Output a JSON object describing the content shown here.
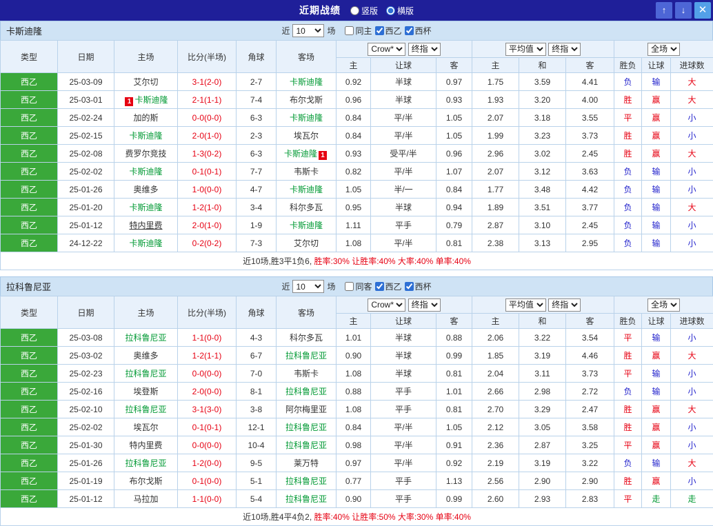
{
  "topbar": {
    "title": "近期战绩",
    "radios": [
      {
        "label": "竖版",
        "selected": false
      },
      {
        "label": "横版",
        "selected": true
      }
    ],
    "up_icon": "↑",
    "down_icon": "↓",
    "close_icon": "✕"
  },
  "filters": {
    "near": "近",
    "count": "10",
    "games": "场",
    "league": "西乙",
    "cup": "西杯"
  },
  "header": {
    "cols": {
      "type": "类型",
      "date": "日期",
      "home": "主场",
      "score": "比分(半场)",
      "corner": "角球",
      "away": "客场"
    },
    "selects": {
      "book": "Crow*",
      "book_kind": "终指",
      "avg": "平均值",
      "avg_kind": "终指",
      "scope": "全场"
    },
    "sub": {
      "home": "主",
      "handicap": "让球",
      "away": "客",
      "avg_home": "主",
      "avg_draw": "和",
      "avg_away": "客",
      "result": "胜负",
      "let_result": "让球",
      "goals": "进球数"
    }
  },
  "sections": [
    {
      "team": "卡斯迪隆",
      "same_label": "同主",
      "same_checked": false,
      "league_checked": true,
      "cup_checked": true,
      "rows": [
        {
          "league": "西乙",
          "date": "25-03-09",
          "home": {
            "name": "艾尔切"
          },
          "score": "3-1(2-0)",
          "corner": "2-7",
          "away": {
            "name": "卡斯迪隆",
            "focus": true
          },
          "odds": [
            "0.92",
            "半球",
            "0.97"
          ],
          "avg": [
            "1.75",
            "3.59",
            "4.41"
          ],
          "result": {
            "t": "负",
            "c": "blue"
          },
          "let": {
            "t": "输",
            "c": "blue"
          },
          "goal": {
            "t": "大",
            "c": "red"
          }
        },
        {
          "league": "西乙",
          "date": "25-03-01",
          "home": {
            "name": "卡斯迪隆",
            "focus": true,
            "card_pre": "1"
          },
          "score": "2-1(1-1)",
          "corner": "7-4",
          "away": {
            "name": "布尔戈斯"
          },
          "odds": [
            "0.96",
            "半球",
            "0.93"
          ],
          "avg": [
            "1.93",
            "3.20",
            "4.00"
          ],
          "result": {
            "t": "胜",
            "c": "red"
          },
          "let": {
            "t": "赢",
            "c": "red"
          },
          "goal": {
            "t": "大",
            "c": "red"
          }
        },
        {
          "league": "西乙",
          "date": "25-02-24",
          "home": {
            "name": "加的斯"
          },
          "score": "0-0(0-0)",
          "corner": "6-3",
          "away": {
            "name": "卡斯迪隆",
            "focus": true
          },
          "odds": [
            "0.84",
            "平/半",
            "1.05"
          ],
          "avg": [
            "2.07",
            "3.18",
            "3.55"
          ],
          "result": {
            "t": "平",
            "c": "red"
          },
          "let": {
            "t": "赢",
            "c": "red"
          },
          "goal": {
            "t": "小",
            "c": "blue"
          }
        },
        {
          "league": "西乙",
          "date": "25-02-15",
          "home": {
            "name": "卡斯迪隆",
            "focus": true
          },
          "score": "2-0(1-0)",
          "corner": "2-3",
          "away": {
            "name": "埃瓦尔"
          },
          "odds": [
            "0.84",
            "平/半",
            "1.05"
          ],
          "avg": [
            "1.99",
            "3.23",
            "3.73"
          ],
          "result": {
            "t": "胜",
            "c": "red"
          },
          "let": {
            "t": "赢",
            "c": "red"
          },
          "goal": {
            "t": "小",
            "c": "blue"
          }
        },
        {
          "league": "西乙",
          "date": "25-02-08",
          "home": {
            "name": "费罗尔竞技"
          },
          "score": "1-3(0-2)",
          "corner": "6-3",
          "away": {
            "name": "卡斯迪隆",
            "focus": true,
            "card_post": "1"
          },
          "odds": [
            "0.93",
            "受平/半",
            "0.96"
          ],
          "avg": [
            "2.96",
            "3.02",
            "2.45"
          ],
          "result": {
            "t": "胜",
            "c": "red"
          },
          "let": {
            "t": "赢",
            "c": "red"
          },
          "goal": {
            "t": "大",
            "c": "red"
          }
        },
        {
          "league": "西乙",
          "date": "25-02-02",
          "home": {
            "name": "卡斯迪隆",
            "focus": true
          },
          "score": "0-1(0-1)",
          "corner": "7-7",
          "away": {
            "name": "韦斯卡"
          },
          "odds": [
            "0.82",
            "平/半",
            "1.07"
          ],
          "avg": [
            "2.07",
            "3.12",
            "3.63"
          ],
          "result": {
            "t": "负",
            "c": "blue"
          },
          "let": {
            "t": "输",
            "c": "blue"
          },
          "goal": {
            "t": "小",
            "c": "blue"
          }
        },
        {
          "league": "西乙",
          "date": "25-01-26",
          "home": {
            "name": "奥维多"
          },
          "score": "1-0(0-0)",
          "corner": "4-7",
          "away": {
            "name": "卡斯迪隆",
            "focus": true
          },
          "odds": [
            "1.05",
            "半/一",
            "0.84"
          ],
          "avg": [
            "1.77",
            "3.48",
            "4.42"
          ],
          "result": {
            "t": "负",
            "c": "blue"
          },
          "let": {
            "t": "输",
            "c": "blue"
          },
          "goal": {
            "t": "小",
            "c": "blue"
          }
        },
        {
          "league": "西乙",
          "date": "25-01-20",
          "home": {
            "name": "卡斯迪隆",
            "focus": true
          },
          "score": "1-2(1-0)",
          "corner": "3-4",
          "away": {
            "name": "科尔多瓦"
          },
          "odds": [
            "0.95",
            "半球",
            "0.94"
          ],
          "avg": [
            "1.89",
            "3.51",
            "3.77"
          ],
          "result": {
            "t": "负",
            "c": "blue"
          },
          "let": {
            "t": "输",
            "c": "blue"
          },
          "goal": {
            "t": "大",
            "c": "red"
          }
        },
        {
          "league": "西乙",
          "date": "25-01-12",
          "home": {
            "name": "特内里费",
            "underline": true
          },
          "score": "2-0(1-0)",
          "corner": "1-9",
          "away": {
            "name": "卡斯迪隆",
            "focus": true
          },
          "odds": [
            "1.11",
            "平手",
            "0.79"
          ],
          "avg": [
            "2.87",
            "3.10",
            "2.45"
          ],
          "result": {
            "t": "负",
            "c": "blue"
          },
          "let": {
            "t": "输",
            "c": "blue"
          },
          "goal": {
            "t": "小",
            "c": "blue"
          }
        },
        {
          "league": "西乙",
          "date": "24-12-22",
          "home": {
            "name": "卡斯迪隆",
            "focus": true
          },
          "score": "0-2(0-2)",
          "corner": "7-3",
          "away": {
            "name": "艾尔切"
          },
          "odds": [
            "1.08",
            "平/半",
            "0.81"
          ],
          "avg": [
            "2.38",
            "3.13",
            "2.95"
          ],
          "result": {
            "t": "负",
            "c": "blue"
          },
          "let": {
            "t": "输",
            "c": "blue"
          },
          "goal": {
            "t": "小",
            "c": "blue"
          }
        }
      ],
      "summary": [
        {
          "t": "近10场,胜3平1负6, ",
          "c": "black"
        },
        {
          "t": "胜率:30% 让胜率:40% 大率:40% 单率:40%",
          "c": "red"
        }
      ]
    },
    {
      "team": "拉科鲁尼亚",
      "same_label": "同客",
      "same_checked": false,
      "league_checked": true,
      "cup_checked": true,
      "rows": [
        {
          "league": "西乙",
          "date": "25-03-08",
          "home": {
            "name": "拉科鲁尼亚",
            "focus": true
          },
          "score": "1-1(0-0)",
          "corner": "4-3",
          "away": {
            "name": "科尔多瓦"
          },
          "odds": [
            "1.01",
            "半球",
            "0.88"
          ],
          "avg": [
            "2.06",
            "3.22",
            "3.54"
          ],
          "result": {
            "t": "平",
            "c": "red"
          },
          "let": {
            "t": "输",
            "c": "blue"
          },
          "goal": {
            "t": "小",
            "c": "blue"
          }
        },
        {
          "league": "西乙",
          "date": "25-03-02",
          "home": {
            "name": "奥维多"
          },
          "score": "1-2(1-1)",
          "corner": "6-7",
          "away": {
            "name": "拉科鲁尼亚",
            "focus": true
          },
          "odds": [
            "0.90",
            "半球",
            "0.99"
          ],
          "avg": [
            "1.85",
            "3.19",
            "4.46"
          ],
          "result": {
            "t": "胜",
            "c": "red"
          },
          "let": {
            "t": "赢",
            "c": "red"
          },
          "goal": {
            "t": "大",
            "c": "red"
          }
        },
        {
          "league": "西乙",
          "date": "25-02-23",
          "home": {
            "name": "拉科鲁尼亚",
            "focus": true
          },
          "score": "0-0(0-0)",
          "corner": "7-0",
          "away": {
            "name": "韦斯卡"
          },
          "odds": [
            "1.08",
            "半球",
            "0.81"
          ],
          "avg": [
            "2.04",
            "3.11",
            "3.73"
          ],
          "result": {
            "t": "平",
            "c": "red"
          },
          "let": {
            "t": "输",
            "c": "blue"
          },
          "goal": {
            "t": "小",
            "c": "blue"
          }
        },
        {
          "league": "西乙",
          "date": "25-02-16",
          "home": {
            "name": "埃登斯"
          },
          "score": "2-0(0-0)",
          "corner": "8-1",
          "away": {
            "name": "拉科鲁尼亚",
            "focus": true
          },
          "odds": [
            "0.88",
            "平手",
            "1.01"
          ],
          "avg": [
            "2.66",
            "2.98",
            "2.72"
          ],
          "result": {
            "t": "负",
            "c": "blue"
          },
          "let": {
            "t": "输",
            "c": "blue"
          },
          "goal": {
            "t": "小",
            "c": "blue"
          }
        },
        {
          "league": "西乙",
          "date": "25-02-10",
          "home": {
            "name": "拉科鲁尼亚",
            "focus": true
          },
          "score": "3-1(3-0)",
          "corner": "3-8",
          "away": {
            "name": "阿尔梅里亚"
          },
          "odds": [
            "1.08",
            "平手",
            "0.81"
          ],
          "avg": [
            "2.70",
            "3.29",
            "2.47"
          ],
          "result": {
            "t": "胜",
            "c": "red"
          },
          "let": {
            "t": "赢",
            "c": "red"
          },
          "goal": {
            "t": "大",
            "c": "red"
          }
        },
        {
          "league": "西乙",
          "date": "25-02-02",
          "home": {
            "name": "埃瓦尔"
          },
          "score": "0-1(0-1)",
          "corner": "12-1",
          "away": {
            "name": "拉科鲁尼亚",
            "focus": true
          },
          "odds": [
            "0.84",
            "平/半",
            "1.05"
          ],
          "avg": [
            "2.12",
            "3.05",
            "3.58"
          ],
          "result": {
            "t": "胜",
            "c": "red"
          },
          "let": {
            "t": "赢",
            "c": "red"
          },
          "goal": {
            "t": "小",
            "c": "blue"
          }
        },
        {
          "league": "西乙",
          "date": "25-01-30",
          "home": {
            "name": "特内里费"
          },
          "score": "0-0(0-0)",
          "corner": "10-4",
          "away": {
            "name": "拉科鲁尼亚",
            "focus": true
          },
          "odds": [
            "0.98",
            "平/半",
            "0.91"
          ],
          "avg": [
            "2.36",
            "2.87",
            "3.25"
          ],
          "result": {
            "t": "平",
            "c": "red"
          },
          "let": {
            "t": "赢",
            "c": "red"
          },
          "goal": {
            "t": "小",
            "c": "blue"
          }
        },
        {
          "league": "西乙",
          "date": "25-01-26",
          "home": {
            "name": "拉科鲁尼亚",
            "focus": true
          },
          "score": "1-2(0-0)",
          "corner": "9-5",
          "away": {
            "name": "莱万特"
          },
          "odds": [
            "0.97",
            "平/半",
            "0.92"
          ],
          "avg": [
            "2.19",
            "3.19",
            "3.22"
          ],
          "result": {
            "t": "负",
            "c": "blue"
          },
          "let": {
            "t": "输",
            "c": "blue"
          },
          "goal": {
            "t": "大",
            "c": "red"
          }
        },
        {
          "league": "西乙",
          "date": "25-01-19",
          "home": {
            "name": "布尔戈斯"
          },
          "score": "0-1(0-0)",
          "corner": "5-1",
          "away": {
            "name": "拉科鲁尼亚",
            "focus": true
          },
          "odds": [
            "0.77",
            "平手",
            "1.13"
          ],
          "avg": [
            "2.56",
            "2.90",
            "2.90"
          ],
          "result": {
            "t": "胜",
            "c": "red"
          },
          "let": {
            "t": "赢",
            "c": "red"
          },
          "goal": {
            "t": "小",
            "c": "blue"
          }
        },
        {
          "league": "西乙",
          "date": "25-01-12",
          "home": {
            "name": "马拉加"
          },
          "score": "1-1(0-0)",
          "corner": "5-4",
          "away": {
            "name": "拉科鲁尼亚",
            "focus": true
          },
          "odds": [
            "0.90",
            "平手",
            "0.99"
          ],
          "avg": [
            "2.60",
            "2.93",
            "2.83"
          ],
          "result": {
            "t": "平",
            "c": "red"
          },
          "let": {
            "t": "走",
            "c": "green"
          },
          "goal": {
            "t": "走",
            "c": "green"
          }
        }
      ],
      "summary": [
        {
          "t": "近10场,胜4平4负2, ",
          "c": "black"
        },
        {
          "t": "胜率:40% 让胜率:50% 大率:30% 单率:40%",
          "c": "red"
        }
      ]
    }
  ]
}
